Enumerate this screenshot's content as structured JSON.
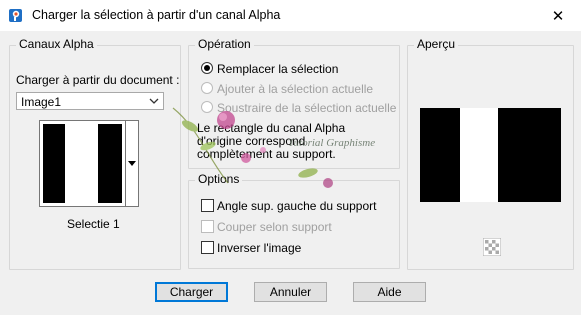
{
  "window": {
    "title": "Charger la sélection à partir d'un canal Alpha",
    "close_glyph": "✕"
  },
  "alpha_channels": {
    "legend": "Canaux Alpha",
    "load_from_label": "Charger à partir du document :",
    "document_select": {
      "value": "Image1"
    },
    "channel_name": "Selectie 1"
  },
  "operation": {
    "legend": "Opération",
    "options": [
      {
        "label": "Remplacer la sélection",
        "checked": true,
        "enabled": true
      },
      {
        "label": "Ajouter à la sélection actuelle",
        "checked": false,
        "enabled": false
      },
      {
        "label": "Soustraire de la sélection actuelle",
        "checked": false,
        "enabled": false
      }
    ],
    "description_line1": "Le rectangle du canal Alpha",
    "description_line2": "d'origine correspond",
    "description_line3": "complètement au support."
  },
  "options": {
    "legend": "Options",
    "checkboxes": [
      {
        "label": "Angle sup. gauche du support",
        "checked": false,
        "enabled": true
      },
      {
        "label": "Couper selon support",
        "checked": false,
        "enabled": false
      },
      {
        "label": "Inverser l'image",
        "checked": false,
        "enabled": true
      }
    ]
  },
  "preview": {
    "legend": "Aperçu"
  },
  "buttons": {
    "ok": "Charger",
    "cancel": "Annuler",
    "help": "Aide"
  },
  "watermark_text": "Tutorial Graphisme",
  "colors": {
    "accent": "#0078d7",
    "border": "#d7d7d7",
    "background": "#f0f0f0"
  }
}
